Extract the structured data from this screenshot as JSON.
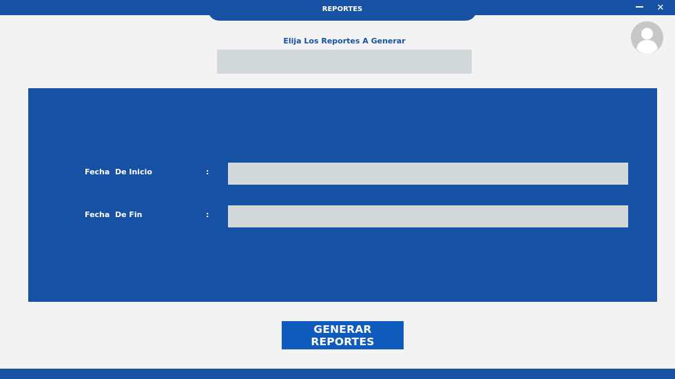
{
  "window": {
    "title": "REPORTES",
    "minimize_icon": "minimize-icon",
    "close_icon": "close-icon",
    "close_glyph": "✕"
  },
  "header": {
    "subtitle": "Elija Los Reportes A Generar",
    "report_select_value": ""
  },
  "form": {
    "start_label": "Fecha  De Inicio",
    "start_colon": ":",
    "start_value": "",
    "end_label": "Fecha  De Fin",
    "end_colon": ":",
    "end_value": ""
  },
  "actions": {
    "generate_label": "GENERAR REPORTES"
  },
  "colors": {
    "brand_blue": "#1751a3",
    "button_blue": "#0e5bbd",
    "input_gray": "#d3d8db",
    "background": "#f3f3f3"
  },
  "icons": {
    "avatar": "user-avatar-icon"
  }
}
